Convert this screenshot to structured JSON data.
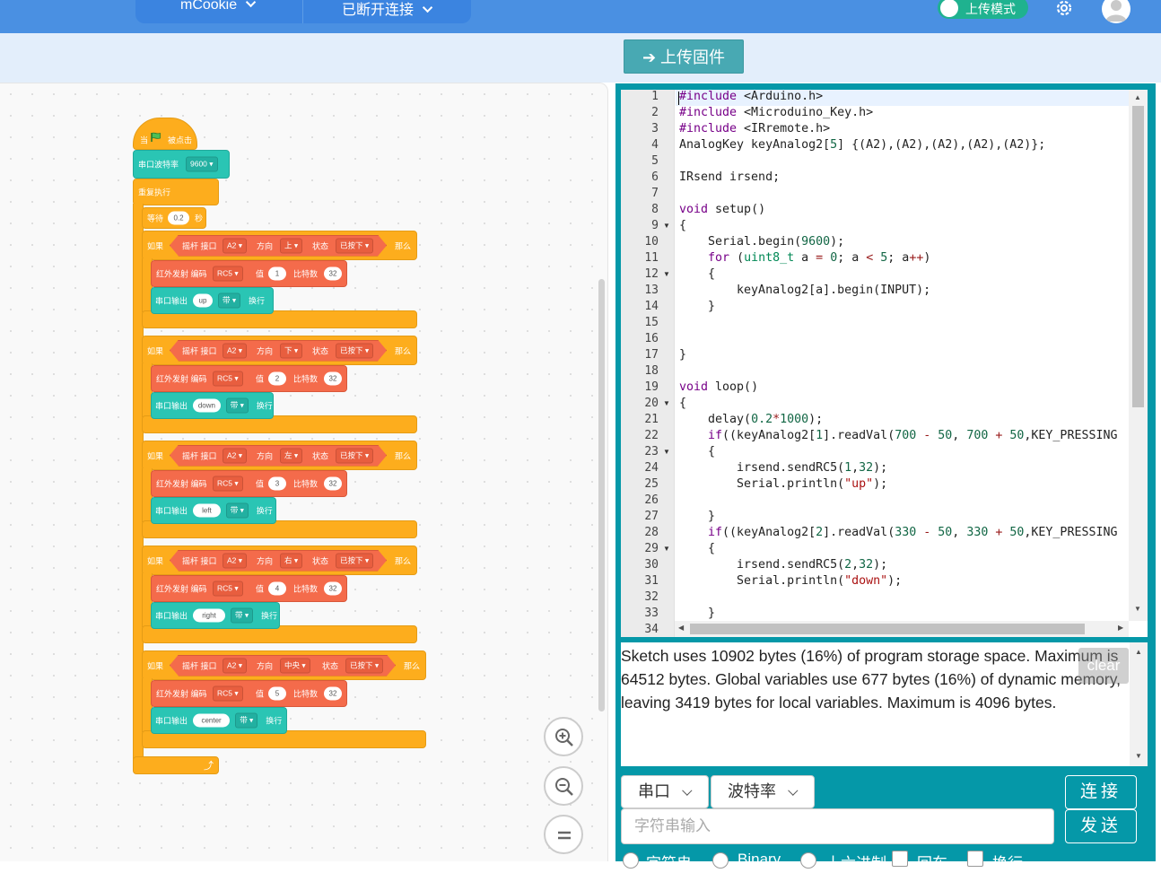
{
  "topbar": {
    "device": "mCookie",
    "connection": "已断开连接",
    "upload_mode": "上传模式"
  },
  "upload_firmware": "上传固件",
  "blocks": {
    "hat": "当",
    "hat_suffix": "被点击",
    "serial_baud_label": "串口波特率",
    "baud": "9600",
    "forever": "重复执行",
    "wait": "等待",
    "wait_value": "0.2",
    "wait_unit": "秒",
    "if": "如果",
    "then": "那么",
    "joystick_port": "摇杆 接口",
    "port": "A2",
    "direction": "方向",
    "state": "状态",
    "pressed": "已按下",
    "ir_send": "红外发射 编码",
    "ir_code": "RC5",
    "ir_value": "值",
    "bits": "比特数",
    "bits_value": "32",
    "serial_out": "串口输出",
    "serial_mode": "带",
    "newline": "换行",
    "items": [
      {
        "dir": "上",
        "value": "1",
        "text": "up"
      },
      {
        "dir": "下",
        "value": "2",
        "text": "down"
      },
      {
        "dir": "左",
        "value": "3",
        "text": "left"
      },
      {
        "dir": "右",
        "value": "4",
        "text": "right"
      },
      {
        "dir": "中央",
        "value": "5",
        "text": "center"
      }
    ]
  },
  "code": {
    "line_count": 34,
    "folds": [
      9,
      12,
      20,
      23,
      29
    ],
    "lines": [
      "#include <Arduino.h>",
      "#include <Microduino_Key.h>",
      "#include <IRremote.h>",
      "AnalogKey keyAnalog2[5] {(A2),(A2),(A2),(A2),(A2)};",
      "",
      "IRsend irsend;",
      "",
      "void setup()",
      "{",
      "    Serial.begin(9600);",
      "    for (uint8_t a = 0; a < 5; a++)",
      "    {",
      "        keyAnalog2[a].begin(INPUT);",
      "    }",
      "",
      "",
      "}",
      "",
      "void loop()",
      "{",
      "    delay(0.2*1000);",
      "    if((keyAnalog2[1].readVal(700 - 50, 700 + 50,KEY_PRESSING",
      "    {",
      "        irsend.sendRC5(1,32);",
      "        Serial.println(\"up\");",
      "",
      "    }",
      "    if((keyAnalog2[2].readVal(330 - 50, 330 + 50,KEY_PRESSING",
      "    {",
      "        irsend.sendRC5(2,32);",
      "        Serial.println(\"down\");",
      "",
      "    }",
      ""
    ]
  },
  "console": {
    "text": "Sketch uses 10902 bytes (16%) of program storage space. Maximum is 64512 bytes. Global variables use 677 bytes (16%) of dynamic memory, leaving 3419 bytes for local variables. Maximum is 4096 bytes.",
    "clear": "clear"
  },
  "serial": {
    "port_label": "串口",
    "baud_label": "波特率",
    "connect": "连接",
    "send": "发送",
    "input_placeholder": "字符串输入",
    "opt_string": "字符串",
    "opt_binary": "Binary",
    "opt_hex": "十六进制",
    "opt_echo": "回车",
    "opt_newline": "换行"
  }
}
